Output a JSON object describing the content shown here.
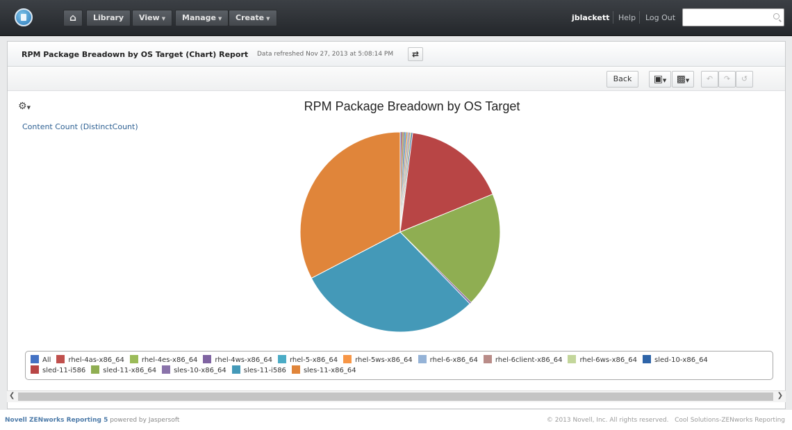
{
  "topbar": {
    "logo": "zenworks-logo",
    "home_icon": "home-icon",
    "menus": [
      {
        "label": "Library",
        "has_caret": false
      },
      {
        "label": "View",
        "has_caret": true
      },
      {
        "label": "Manage",
        "has_caret": true
      },
      {
        "label": "Create",
        "has_caret": true
      }
    ],
    "user": "jblackett",
    "help": "Help",
    "logout": "Log Out",
    "search_placeholder": ""
  },
  "report": {
    "title": "RPM Package Breadown by OS Target (Chart) Report",
    "refreshed": "Data refreshed Nov 27, 2013 at 5:08:14 PM",
    "refresh_icon": "refresh-icon"
  },
  "toolbar": {
    "back_label": "Back",
    "buttons": [
      "save-icon",
      "export-icon",
      "undo-icon",
      "redo-icon",
      "undo-all-icon"
    ]
  },
  "measure_label": "Content Count (DistinctCount)",
  "chart_data": {
    "type": "pie",
    "title": "RPM Package Breadown by OS Target",
    "series": [
      {
        "name": "All",
        "value": 0.2,
        "color": "#4472c4"
      },
      {
        "name": "rhel-4as-x86_64",
        "value": 0.2,
        "color": "#c0504d"
      },
      {
        "name": "rhel-4es-x86_64",
        "value": 0.2,
        "color": "#9bbb59"
      },
      {
        "name": "rhel-4ws-x86_64",
        "value": 0.2,
        "color": "#8064a2"
      },
      {
        "name": "rhel-5-x86_64",
        "value": 0.2,
        "color": "#4bacc6"
      },
      {
        "name": "rhel-5ws-x86_64",
        "value": 0.2,
        "color": "#f79646"
      },
      {
        "name": "rhel-6-x86_64",
        "value": 0.2,
        "color": "#95b3d7"
      },
      {
        "name": "rhel-6client-x86_64",
        "value": 0.2,
        "color": "#b98c88"
      },
      {
        "name": "rhel-6ws-x86_64",
        "value": 0.2,
        "color": "#c3d69b"
      },
      {
        "name": "sled-10-x86_64",
        "value": 0.2,
        "color": "#2e64a8"
      },
      {
        "name": "sled-11-i586",
        "value": 16.8,
        "color": "#b84545"
      },
      {
        "name": "sled-11-x86_64",
        "value": 18.6,
        "color": "#8fae52"
      },
      {
        "name": "sles-10-x86_64",
        "value": 0.3,
        "color": "#8a73aa"
      },
      {
        "name": "sles-11-i586",
        "value": 29.6,
        "color": "#4499b8"
      },
      {
        "name": "sles-11-x86_64",
        "value": 32.6,
        "color": "#e0853a"
      }
    ]
  },
  "footer": {
    "product": "Novell ZENworks Reporting 5",
    "powered": " powered by Jaspersoft",
    "copyright": "© 2013 Novell, Inc. All rights reserved.",
    "link": "Cool Solutions-ZENworks Reporting"
  }
}
